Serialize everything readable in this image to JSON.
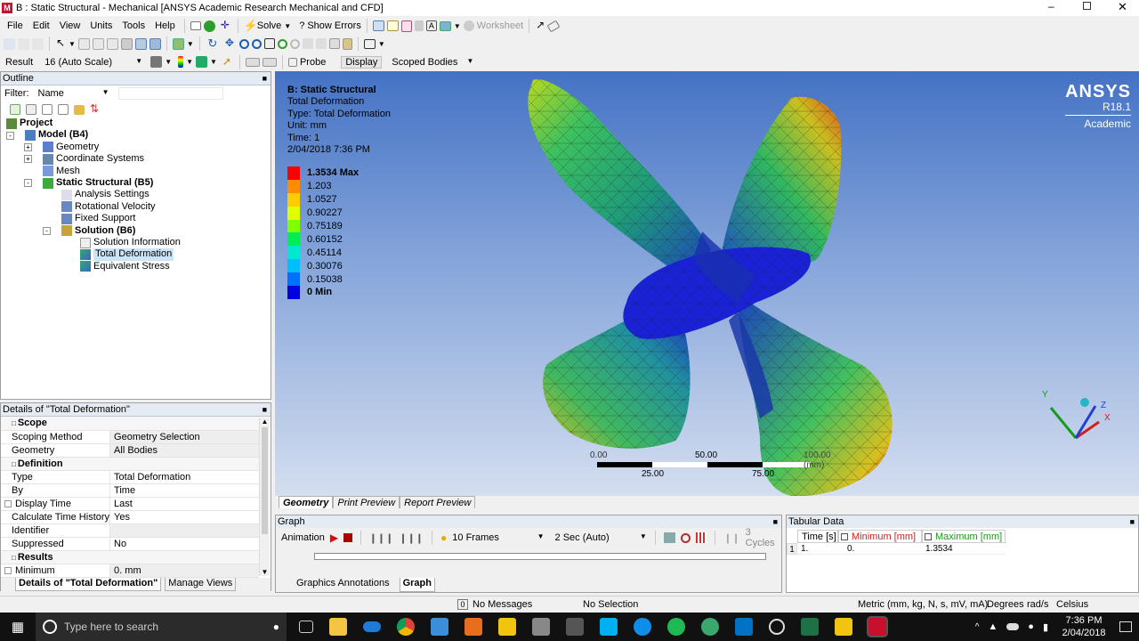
{
  "window": {
    "title": "B : Static Structural - Mechanical [ANSYS Academic Research Mechanical and CFD]",
    "app_icon": "M"
  },
  "menu": [
    "File",
    "Edit",
    "View",
    "Units",
    "Tools",
    "Help"
  ],
  "toolbar1": {
    "solve": "Solve",
    "show_errors": "Show Errors",
    "worksheet": "Worksheet"
  },
  "toolbar3": {
    "result_label": "Result",
    "scale": "16 (Auto Scale)",
    "probe": "Probe",
    "display": "Display",
    "scoped": "Scoped Bodies"
  },
  "outline": {
    "title": "Outline",
    "filter_label": "Filter:",
    "filter_value": "Name",
    "tree": [
      {
        "label": "Project",
        "bold": true,
        "indent": 0,
        "expander": "",
        "icon": "project-icon"
      },
      {
        "label": "Model (B4)",
        "bold": true,
        "indent": 1,
        "expander": "-",
        "icon": "model-icon"
      },
      {
        "label": "Geometry",
        "bold": false,
        "indent": 2,
        "expander": "+",
        "icon": "geometry-icon"
      },
      {
        "label": "Coordinate Systems",
        "bold": false,
        "indent": 2,
        "expander": "+",
        "icon": "coordinate-systems-icon"
      },
      {
        "label": "Mesh",
        "bold": false,
        "indent": 2,
        "expander": "",
        "icon": "mesh-icon"
      },
      {
        "label": "Static Structural (B5)",
        "bold": true,
        "indent": 2,
        "expander": "-",
        "icon": "static-structural-icon"
      },
      {
        "label": "Analysis Settings",
        "bold": false,
        "indent": 3,
        "expander": "",
        "icon": "analysis-settings-icon"
      },
      {
        "label": "Rotational Velocity",
        "bold": false,
        "indent": 3,
        "expander": "",
        "icon": "rotational-velocity-icon"
      },
      {
        "label": "Fixed Support",
        "bold": false,
        "indent": 3,
        "expander": "",
        "icon": "fixed-support-icon"
      },
      {
        "label": "Solution (B6)",
        "bold": true,
        "indent": 3,
        "expander": "-",
        "icon": "solution-icon"
      },
      {
        "label": "Solution Information",
        "bold": false,
        "indent": 4,
        "expander": "",
        "icon": "solution-information-icon"
      },
      {
        "label": "Total Deformation",
        "bold": false,
        "indent": 4,
        "expander": "",
        "icon": "total-deformation-icon",
        "selected": true
      },
      {
        "label": "Equivalent Stress",
        "bold": false,
        "indent": 4,
        "expander": "",
        "icon": "equivalent-stress-icon"
      }
    ]
  },
  "details": {
    "title": "Details of \"Total Deformation\"",
    "rows": [
      {
        "section": "Scope"
      },
      {
        "k": "Scoping Method",
        "v": "Geometry Selection"
      },
      {
        "k": "Geometry",
        "v": "All Bodies"
      },
      {
        "section": "Definition"
      },
      {
        "k": "Type",
        "v": "Total Deformation"
      },
      {
        "k": "By",
        "v": "Time"
      },
      {
        "k": "Display Time",
        "v": "Last",
        "cb": true
      },
      {
        "k": "Calculate Time History",
        "v": "Yes"
      },
      {
        "k": "Identifier",
        "v": ""
      },
      {
        "k": "Suppressed",
        "v": "No"
      },
      {
        "section": "Results"
      },
      {
        "k": "Minimum",
        "v": "0. mm",
        "cb": true
      }
    ],
    "tabs": [
      "Details of \"Total Deformation\"",
      "Manage Views"
    ]
  },
  "viewport": {
    "info": [
      "B: Static Structural",
      "Total Deformation",
      "Type: Total Deformation",
      "Unit: mm",
      "Time: 1",
      "2/04/2018 7:36 PM"
    ],
    "legend": [
      {
        "label": "1.3534 Max",
        "color": "#ff0000",
        "bold": true
      },
      {
        "label": "1.203",
        "color": "#ff8c00"
      },
      {
        "label": "1.0527",
        "color": "#ffcc00"
      },
      {
        "label": "0.90227",
        "color": "#e0ff00"
      },
      {
        "label": "0.75189",
        "color": "#7fff00"
      },
      {
        "label": "0.60152",
        "color": "#00ee55"
      },
      {
        "label": "0.45114",
        "color": "#00e8d0"
      },
      {
        "label": "0.30076",
        "color": "#00bfff"
      },
      {
        "label": "0.15038",
        "color": "#0070ff"
      },
      {
        "label": "0 Min",
        "color": "#0000e0",
        "bold": true
      }
    ],
    "scale_labels": {
      "a": "0.00",
      "b": "50.00",
      "c": "100.00 (mm)",
      "d": "25.00",
      "e": "75.00"
    },
    "logo": {
      "brand": "ANSYS",
      "version": "R18.1",
      "edition": "Academic"
    },
    "axes": {
      "x": "X",
      "y": "Y",
      "z": "Z"
    },
    "tabs": [
      "Geometry",
      "Print Preview",
      "Report Preview"
    ]
  },
  "graph": {
    "title": "Graph",
    "animation": "Animation",
    "frames": "10 Frames",
    "duration": "2 Sec (Auto)",
    "cycles": "3 Cycles",
    "tabs": [
      "Graphics Annotations",
      "Graph"
    ]
  },
  "tabular": {
    "title": "Tabular Data",
    "headers": [
      "Time [s]",
      "Minimum [mm]",
      "Maximum [mm]"
    ],
    "rows": [
      [
        "1",
        "1.",
        "0.",
        "1.3534"
      ]
    ]
  },
  "status": {
    "messages": "No Messages",
    "selection": "No Selection",
    "units": "Metric (mm, kg, N, s, mV, mA)",
    "angle": "Degrees",
    "angvel": "rad/s",
    "temp": "Celsius"
  },
  "taskbar": {
    "search": "Type here to search",
    "time": "7:36 PM",
    "date": "2/04/2018"
  }
}
